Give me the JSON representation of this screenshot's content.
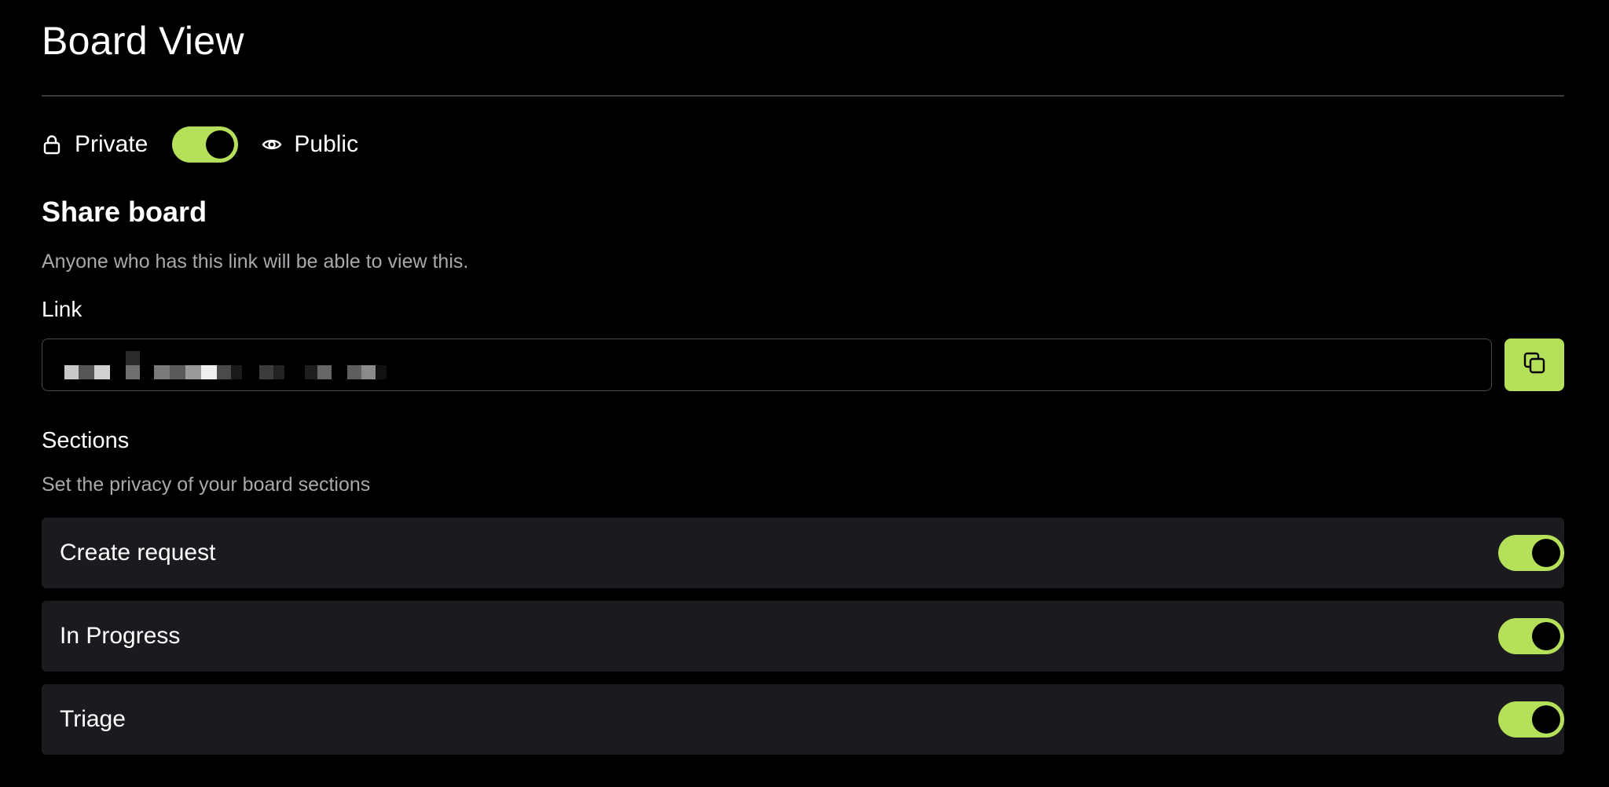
{
  "page": {
    "title": "Board View"
  },
  "visibility": {
    "private_label": "Private",
    "public_label": "Public",
    "toggle_state": "on",
    "icons": {
      "private": "lock-icon",
      "public": "eye-icon"
    }
  },
  "share": {
    "title": "Share board",
    "description": "Anyone who has this link will be able to view this.",
    "link_label": "Link",
    "link_value_redacted": true,
    "copy_icon": "copy-icon"
  },
  "sections": {
    "title": "Sections",
    "description": "Set the privacy of your board sections",
    "items": [
      {
        "label": "Create request",
        "enabled": true
      },
      {
        "label": "In Progress",
        "enabled": true
      },
      {
        "label": "Triage",
        "enabled": true
      }
    ]
  },
  "colors": {
    "background": "#000000",
    "accent": "#b4e05a",
    "row_background": "#1b1b1f",
    "muted_text": "#a8a8ad",
    "divider": "#3a3a3c"
  }
}
